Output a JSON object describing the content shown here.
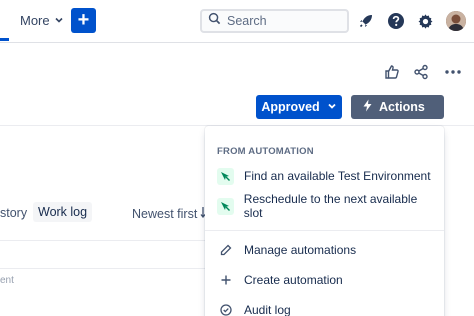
{
  "nav": {
    "partial_tab_label": "",
    "more_label": "More",
    "create_label": "+",
    "search_placeholder": "Search"
  },
  "issue_header": {
    "status_label": "Approved",
    "actions_label": "Actions"
  },
  "activity": {
    "tab_history_label": "story",
    "tab_worklog_label": "Work log",
    "sort_label": "Newest first",
    "comment_hint": "ent"
  },
  "actions_menu": {
    "section_title": "FROM AUTOMATION",
    "automation_items": [
      {
        "label": "Find an available Test Environment",
        "icon": "automation-rule-icon"
      },
      {
        "label": "Reschedule to the next available slot",
        "icon": "automation-rule-icon"
      }
    ],
    "manage_label": "Manage automations",
    "create_label": "Create automation",
    "audit_label": "Audit log"
  },
  "colors": {
    "primary": "#0052cc",
    "actions_button": "#505f79",
    "automation_icon_bg": "#e3fcef",
    "automation_icon_fg": "#00875a"
  }
}
